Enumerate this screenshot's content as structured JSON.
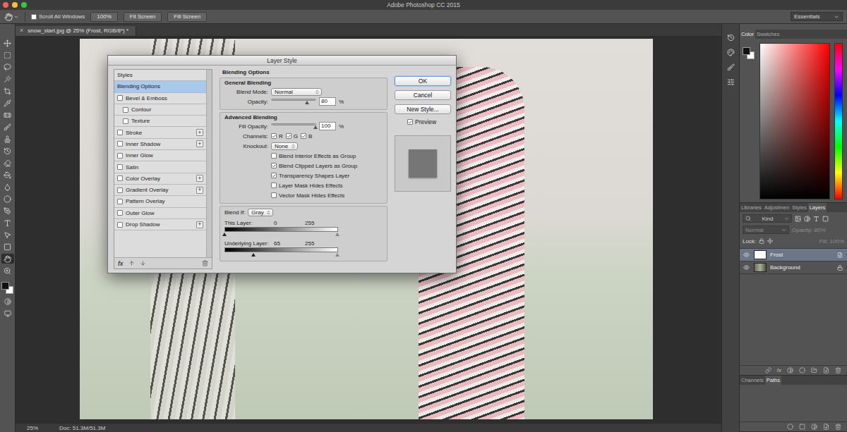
{
  "window": {
    "title": "Adobe Photoshop CC 2015",
    "controls": [
      {
        "name": "close",
        "color": "#fc605c"
      },
      {
        "name": "minimize",
        "color": "#fdbc40"
      },
      {
        "name": "zoom",
        "color": "#34c84a"
      }
    ]
  },
  "options_bar": {
    "scroll_all_windows": {
      "label": "Scroll All Windows",
      "checked": false
    },
    "buttons": [
      "100%",
      "Fit Screen",
      "Fill Screen"
    ],
    "workspace": "Essentials"
  },
  "toolbar": {
    "tools": [
      {
        "selected": false
      },
      {
        "selected": false
      },
      {
        "selected": false
      },
      {
        "selected": false
      },
      {
        "selected": false
      },
      {
        "selected": false
      },
      {
        "selected": false
      },
      {
        "selected": false
      },
      {
        "selected": false
      },
      {
        "selected": false
      },
      {
        "selected": false
      },
      {
        "selected": false
      },
      {
        "selected": false
      },
      {
        "selected": false
      },
      {
        "selected": false
      },
      {
        "selected": false
      },
      {
        "selected": false
      },
      {
        "selected": false
      },
      {
        "selected": true
      },
      {
        "selected": false
      }
    ]
  },
  "document_tab": {
    "title": "snow_start.jpg @ 25% (Frost, RGB/8*) *",
    "close": "×",
    "selected": true
  },
  "layer_style": {
    "title": "Layer Style",
    "add_glyph": "+",
    "fx": "fx",
    "styles": [
      {
        "label": "Styles",
        "kind": "header",
        "selected": false,
        "plus": false
      },
      {
        "label": "Blending Options",
        "kind": "header",
        "selected": true,
        "plus": false
      },
      {
        "label": "Bevel & Emboss",
        "kind": "effect",
        "selected": false,
        "checked": false,
        "plus": false
      },
      {
        "label": "Contour",
        "kind": "sub",
        "selected": false,
        "checked": false,
        "plus": false
      },
      {
        "label": "Texture",
        "kind": "sub",
        "selected": false,
        "checked": false,
        "plus": false
      },
      {
        "label": "Stroke",
        "kind": "effect",
        "selected": false,
        "checked": false,
        "plus": true
      },
      {
        "label": "Inner Shadow",
        "kind": "effect",
        "selected": false,
        "checked": false,
        "plus": true
      },
      {
        "label": "Inner Glow",
        "kind": "effect",
        "selected": false,
        "checked": false,
        "plus": false
      },
      {
        "label": "Satin",
        "kind": "effect",
        "selected": false,
        "checked": false,
        "plus": false
      },
      {
        "label": "Color Overlay",
        "kind": "effect",
        "selected": false,
        "checked": false,
        "plus": true
      },
      {
        "label": "Gradient Overlay",
        "kind": "effect",
        "selected": false,
        "checked": false,
        "plus": true
      },
      {
        "label": "Pattern Overlay",
        "kind": "effect",
        "selected": false,
        "checked": false,
        "plus": false
      },
      {
        "label": "Outer Glow",
        "kind": "effect",
        "selected": false,
        "checked": false,
        "plus": false
      },
      {
        "label": "Drop Shadow",
        "kind": "effect",
        "selected": false,
        "checked": false,
        "plus": true
      }
    ],
    "heading": "Blending Options",
    "general": {
      "heading": "General Blending",
      "blend_mode": {
        "label": "Blend Mode:",
        "value": "Normal"
      },
      "opacity": {
        "label": "Opacity:",
        "value": "80",
        "unit": "%",
        "level": 0.8
      }
    },
    "advanced": {
      "heading": "Advanced Blending",
      "fill_opacity": {
        "label": "Fill Opacity:",
        "value": "100",
        "unit": "%",
        "level": 1
      },
      "channels": {
        "label": "Channels:",
        "items": [
          {
            "label": "R",
            "checked": true
          },
          {
            "label": "G",
            "checked": true
          },
          {
            "label": "B",
            "checked": true
          }
        ]
      },
      "knockout": {
        "label": "Knockout:",
        "value": "None"
      },
      "options": [
        {
          "label": "Blend Interior Effects as Group",
          "checked": false
        },
        {
          "label": "Blend Clipped Layers as Group",
          "checked": true
        },
        {
          "label": "Transparency Shapes Layer",
          "checked": true
        },
        {
          "label": "Layer Mask Hides Effects",
          "checked": false
        },
        {
          "label": "Vector Mask Hides Effects",
          "checked": false
        }
      ]
    },
    "blend_if": {
      "label": "Blend If:",
      "value": "Gray",
      "ranges": [
        {
          "label": "This Layer:",
          "low": "0",
          "high": "255",
          "low_level": 0,
          "high_level": 1
        },
        {
          "label": "Underlying Layer:",
          "low": "65",
          "high": "255",
          "low_level": 0.255,
          "high_level": 1
        }
      ]
    },
    "buttons": [
      {
        "label": "OK",
        "default": true
      },
      {
        "label": "Cancel",
        "default": false
      },
      {
        "label": "New Style...",
        "default": false
      }
    ],
    "preview": {
      "label": "Preview",
      "checked": true
    }
  },
  "color_panel": {
    "tabs": [
      {
        "label": "Color",
        "selected": true
      },
      {
        "label": "Swatches",
        "selected": false
      }
    ]
  },
  "layers_panel": {
    "tabs": [
      {
        "label": "Libraries",
        "selected": false
      },
      {
        "label": "Adjustmen",
        "selected": false
      },
      {
        "label": "Styles",
        "selected": false
      },
      {
        "label": "Layers",
        "selected": true
      }
    ],
    "filter": "Kind",
    "blend_mode": "Normal",
    "opacity": {
      "label": "Opacity:",
      "value": "80%",
      "disabled": true
    },
    "lock": {
      "label": "Lock:"
    },
    "fill": {
      "label": "Fill:",
      "value": "100%",
      "disabled": true
    },
    "fx": "fx",
    "layers": [
      {
        "name": "Frost",
        "selected": true,
        "visible": true,
        "locked": false
      },
      {
        "name": "Background",
        "selected": false,
        "visible": true,
        "locked": true
      }
    ]
  },
  "bottom_panel": {
    "tabs": [
      {
        "label": "Channels",
        "selected": false
      },
      {
        "label": "Paths",
        "selected": true
      }
    ]
  },
  "status_bar": {
    "zoom": "25%",
    "doc": "Doc: 51.3M/51.3M"
  }
}
